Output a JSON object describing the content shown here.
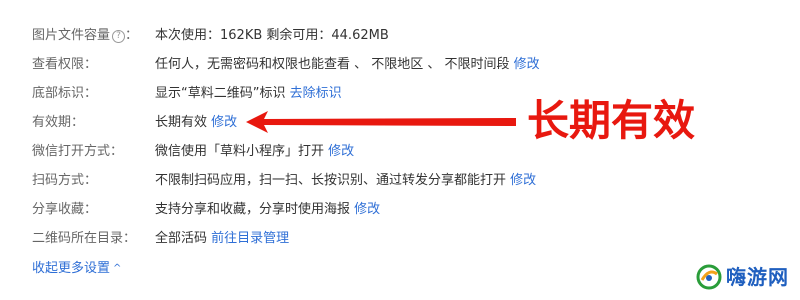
{
  "settings": {
    "rows": [
      {
        "label": "图片文件容量",
        "value": "本次使用：162KB   剩余可用：44.62MB",
        "link": ""
      },
      {
        "label": "查看权限：",
        "value": "任何人，无需密码和权限也能查看 、 不限地区 、 不限时间段",
        "link": "修改"
      },
      {
        "label": "底部标识：",
        "value": "显示“草料二维码”标识",
        "link": "去除标识"
      },
      {
        "label": "有效期：",
        "value": "长期有效",
        "link": "修改"
      },
      {
        "label": "微信打开方式：",
        "value": "微信使用「草料小程序」打开",
        "link": "修改"
      },
      {
        "label": "扫码方式：",
        "value": "不限制扫码应用，扫一扫、长按识别、通过转发分享都能打开",
        "link": "修改"
      },
      {
        "label": "分享收藏：",
        "value": "支持分享和收藏，分享时使用海报",
        "link": "修改"
      },
      {
        "label": "二维码所在目录：",
        "value": "全部活码",
        "link": "前往目录管理"
      }
    ],
    "help_glyph": "?",
    "help_colon": "：",
    "collapse_label": "收起更多设置",
    "collapse_glyph": "^"
  },
  "annotation": {
    "text": "长期有效",
    "color": "#e8180f"
  },
  "watermark": {
    "text": "嗨游网"
  },
  "colors": {
    "link": "#2f6fd6",
    "label": "#666666",
    "value": "#333333"
  }
}
